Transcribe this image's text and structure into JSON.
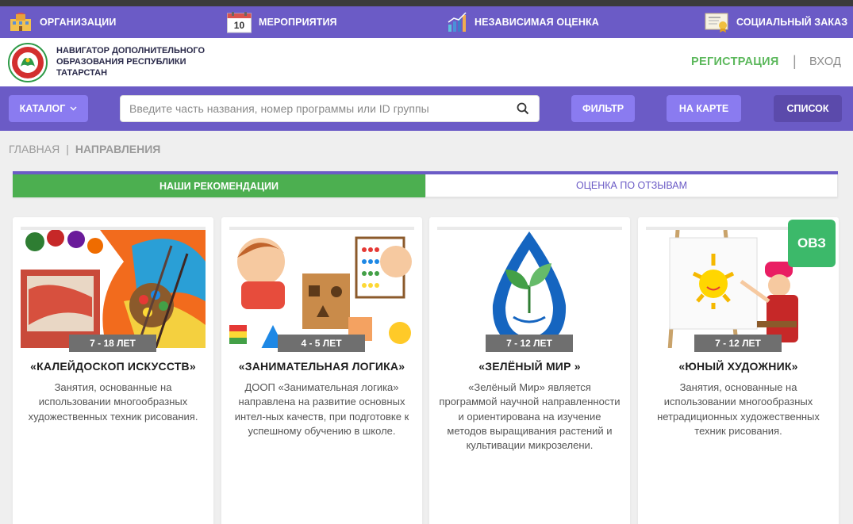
{
  "nav": {
    "items": [
      {
        "label": "ОРГАНИЗАЦИИ",
        "icon": "buildings-icon"
      },
      {
        "label": "МЕРОПРИЯТИЯ",
        "icon": "calendar-icon",
        "icon_text": "10"
      },
      {
        "label": "НЕЗАВИСИМАЯ ОЦЕНКА",
        "icon": "chart-icon"
      },
      {
        "label": "СОЦИАЛЬНЫЙ ЗАКАЗ",
        "icon": "certificate-icon"
      }
    ]
  },
  "brand": {
    "title": "НАВИГАТОР ДОПОЛНИТЕЛЬНОГО ОБРАЗОВАНИЯ РЕСПУБЛИКИ ТАТАРСТАН",
    "register": "РЕГИСТРАЦИЯ",
    "separator": "|",
    "login": "ВХОД"
  },
  "search": {
    "catalog_label": "КАТАЛОГ",
    "placeholder": "Введите часть названия, номер программы или ID группы",
    "filter_label": "ФИЛЬТР",
    "map_label": "НА КАРТЕ",
    "list_label": "СПИСОК"
  },
  "breadcrumb": {
    "home": "ГЛАВНАЯ",
    "separator": "|",
    "current": "НАПРАВЛЕНИЯ"
  },
  "tabs": [
    {
      "label": "НАШИ РЕКОМЕНДАЦИИ",
      "active": true
    },
    {
      "label": "ОЦЕНКА ПО ОТЗЫВАМ",
      "active": false
    }
  ],
  "cards": [
    {
      "age": "7 - 18 ЛЕТ",
      "title": "«КАЛЕЙДОСКОП ИСКУССТВ»",
      "description": "Занятия, основанные на использовании многообразных художественных техник рисования."
    },
    {
      "age": "4 - 5 ЛЕТ",
      "title": "«ЗАНИМАТЕЛЬНАЯ ЛОГИКА»",
      "description": "ДООП «Занимательная логика» направлена на развитие основных интел-ных качеств, при подготовке к успешному обучению в школе."
    },
    {
      "age": "7 - 12 ЛЕТ",
      "title": "«ЗЕЛЁНЫЙ МИР »",
      "description": "«Зелёный Мир» является программой научной направленности и ориентирована на изучение методов выращивания растений и культивации микрозелени."
    },
    {
      "age": "7 - 12 ЛЕТ",
      "title": "«ЮНЫЙ ХУДОЖНИК»",
      "description": "Занятия, основанные на использовании многообразных нетрадиционных художественных техник рисования.",
      "badge": "ОВЗ"
    }
  ],
  "colors": {
    "primary": "#6b5bc6",
    "button": "#8a7bf0",
    "accent_green": "#4caf50",
    "badge_green": "#3cb96a"
  }
}
